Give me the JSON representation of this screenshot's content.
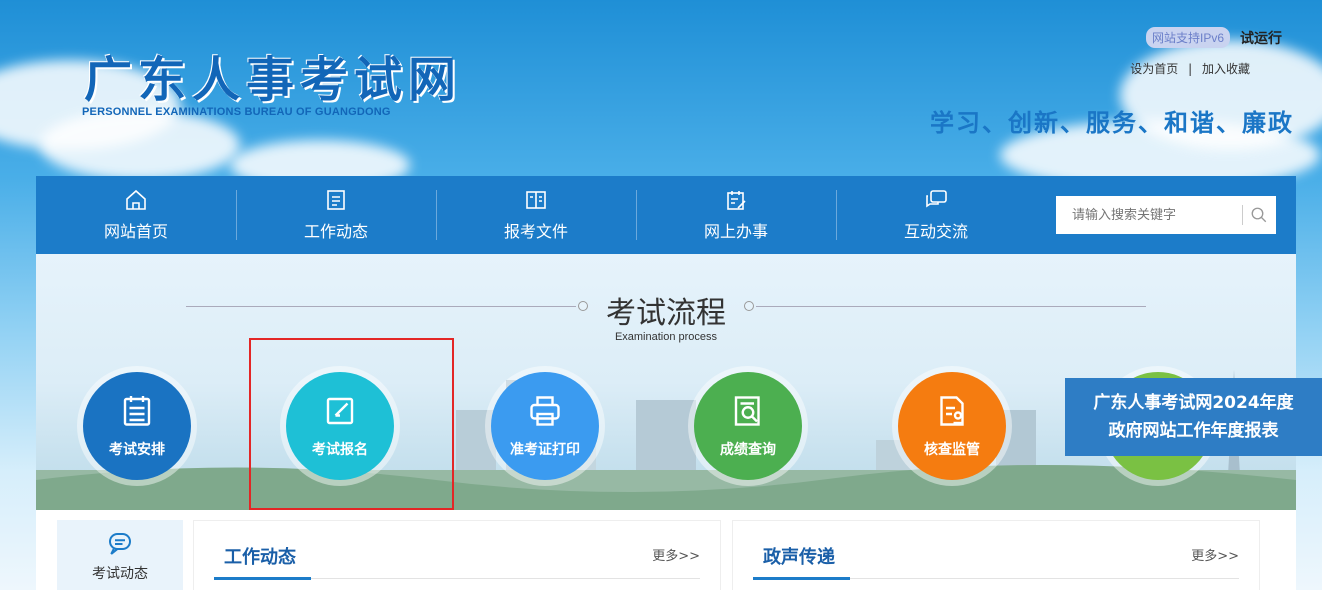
{
  "header": {
    "site_title": "广东人事考试网",
    "site_subtitle": "PERSONNEL EXAMINATIONS BUREAU OF GUANGDONG",
    "ipv6_badge": "网站支持IPv6",
    "trial_label": "试运行",
    "set_home": "设为首页",
    "link_separator": "|",
    "add_favorite": "加入收藏",
    "slogan": "学习、创新、服务、和谐、廉政"
  },
  "nav": {
    "items": [
      {
        "label": "网站首页",
        "icon": "home-icon"
      },
      {
        "label": "工作动态",
        "icon": "document-icon"
      },
      {
        "label": "报考文件",
        "icon": "book-icon"
      },
      {
        "label": "网上办事",
        "icon": "calendar-edit-icon"
      },
      {
        "label": "互动交流",
        "icon": "chat-icon"
      }
    ],
    "search_placeholder": "请输入搜索关键字"
  },
  "process": {
    "title": "考试流程",
    "subtitle": "Examination process",
    "steps": [
      {
        "label": "考试安排",
        "color": "#1a73c2",
        "icon": "schedule-icon"
      },
      {
        "label": "考试报名",
        "color": "#1ec0d6",
        "icon": "edit-icon"
      },
      {
        "label": "准考证打印",
        "color": "#3b9bf0",
        "icon": "printer-icon"
      },
      {
        "label": "成绩查询",
        "color": "#4caf50",
        "icon": "search-document-icon"
      },
      {
        "label": "核查监管",
        "color": "#f57c10",
        "icon": "supervision-icon"
      },
      {
        "label": "",
        "color": "#7ac143",
        "icon": "unknown-icon"
      }
    ],
    "highlighted_step": "考试报名"
  },
  "report_banner": {
    "line1": "广东人事考试网2024年度",
    "line2": "政府网站工作年度报表"
  },
  "bottom": {
    "side_tab": "考试动态",
    "columns": [
      {
        "title": "工作动态",
        "more": "更多>>"
      },
      {
        "title": "政声传递",
        "more": "更多>>"
      }
    ]
  },
  "colors": {
    "nav_bg": "#1c7cc9",
    "title_blue": "#1266b8",
    "highlight_red": "#e32626",
    "report_bg": "#2e7dc5"
  }
}
